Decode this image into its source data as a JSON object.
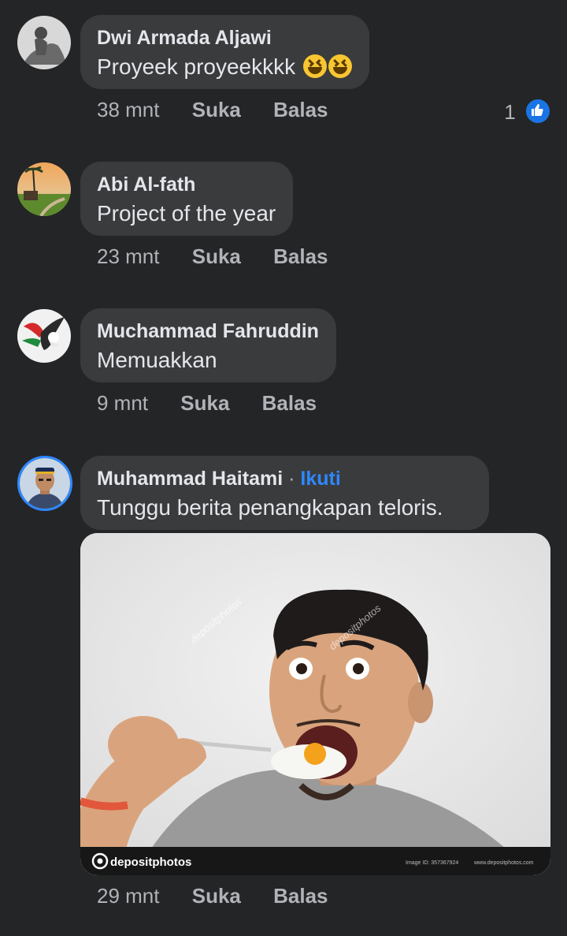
{
  "comments": [
    {
      "author": "Dwi Armada Aljawi",
      "text": "Proyeek proyeekkkk",
      "time": "38 mnt",
      "like_label": "Suka",
      "reply_label": "Balas",
      "reaction_count": "1"
    },
    {
      "author": "Abi Al-fath",
      "text": "Project of the year",
      "time": "23 mnt",
      "like_label": "Suka",
      "reply_label": "Balas"
    },
    {
      "author": "Muchammad Fahruddin",
      "text": "Memuakkan",
      "time": "9 mnt",
      "like_label": "Suka",
      "reply_label": "Balas"
    },
    {
      "author": "Muhammad Haitami",
      "follow_label": "Ikuti",
      "separator": "·",
      "text": "Tunggu berita penangkapan teloris.",
      "time": "29 mnt",
      "like_label": "Suka",
      "reply_label": "Balas"
    }
  ],
  "meme": {
    "watermark": "depositphotos",
    "brand": "depositphotos",
    "image_id": "Image ID: 357367924",
    "site": "www.depositphotos.com"
  },
  "colors": {
    "background": "#242526",
    "bubble": "#3a3b3c",
    "text": "#e4e6eb",
    "secondary": "#b0b3b8",
    "accent": "#2d88ff",
    "like": "#1b74e4"
  }
}
